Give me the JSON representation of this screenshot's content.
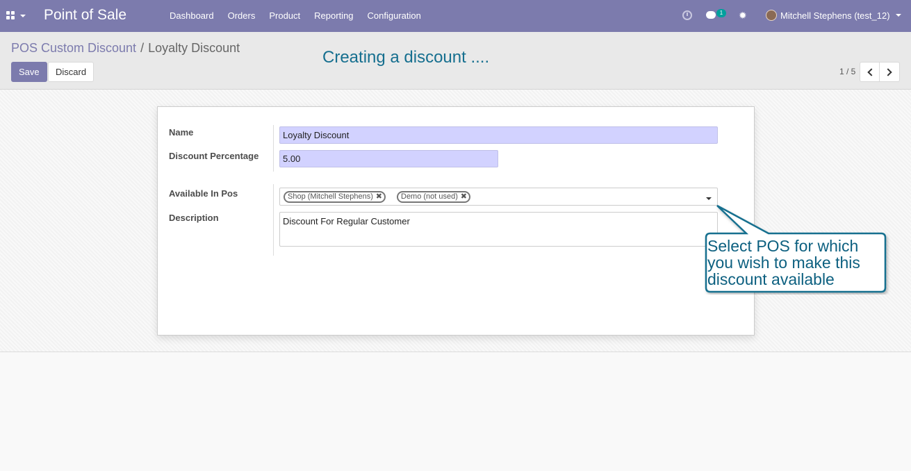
{
  "navbar": {
    "app_title": "Point of Sale",
    "menu": [
      "Dashboard",
      "Orders",
      "Product",
      "Reporting",
      "Configuration"
    ],
    "chat_count": "1",
    "user_name": "Mitchell Stephens (test_12)"
  },
  "breadcrumb": {
    "parent": "POS Custom Discount",
    "separator": "/",
    "current": "Loyalty Discount"
  },
  "toolbar": {
    "save_label": "Save",
    "discard_label": "Discard"
  },
  "pager": {
    "text": "1 / 5"
  },
  "annotation": {
    "title": "Creating a discount ....",
    "callout": "Select POS for which you wish to make this discount available"
  },
  "form": {
    "name_label": "Name",
    "name_value": "Loyalty Discount",
    "discount_label": "Discount Percentage",
    "discount_value": "5.00",
    "pos_label": "Available In Pos",
    "pos_tags": [
      "Shop (Mitchell Stephens)",
      "Demo (not used)"
    ],
    "description_label": "Description",
    "description_value": "Discount For Regular Customer"
  },
  "colors": {
    "brand": "#7c7bad",
    "input_required": "#d2d2ff",
    "annotation_text": "#166f8f",
    "callout_border": "#166f8f"
  }
}
